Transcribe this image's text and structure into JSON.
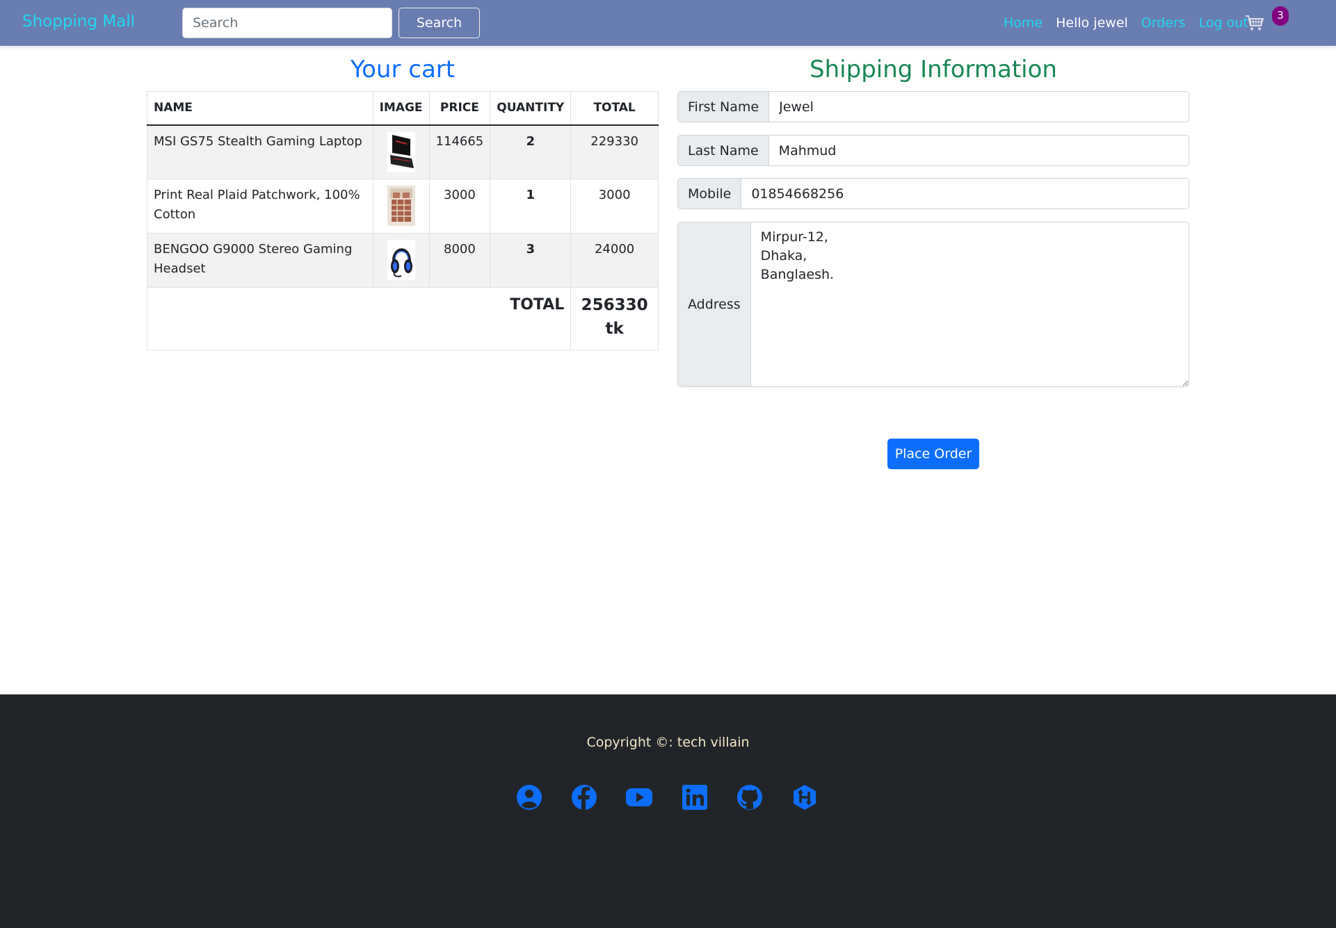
{
  "navbar": {
    "brand": "Shopping Mall",
    "search_placeholder": "Search",
    "search_button": "Search",
    "links": {
      "home": "Home",
      "greeting": "Hello jewel",
      "orders": "Orders",
      "logout": "Log out"
    },
    "cart_icon": "cart-icon",
    "cart_count": "3",
    "colors": {
      "bar": "#6a7db0",
      "link": "#20d9f2",
      "badge": "#800080"
    }
  },
  "cart": {
    "title": "Your cart",
    "columns": [
      "NAME",
      "IMAGE",
      "PRICE",
      "QUANTITY",
      "TOTAL"
    ],
    "items": [
      {
        "name": "MSI GS75 Stealth Gaming Laptop",
        "image_icon": "laptop-thumbnail",
        "price": "114665",
        "quantity": "2",
        "total": "229330"
      },
      {
        "name": "Print Real Plaid Patchwork, 100% Cotton",
        "image_icon": "bedding-thumbnail",
        "price": "3000",
        "quantity": "1",
        "total": "3000"
      },
      {
        "name": "BENGOO G9000 Stereo Gaming Headset",
        "image_icon": "headset-thumbnail",
        "price": "8000",
        "quantity": "3",
        "total": "24000"
      }
    ],
    "total_label": "TOTAL",
    "total_value": "256330",
    "total_unit": "tk"
  },
  "shipping": {
    "title": "Shipping Information",
    "first_name": {
      "label": "First Name",
      "value": "Jewel"
    },
    "last_name": {
      "label": "Last Name",
      "value": "Mahmud"
    },
    "mobile": {
      "label": "Mobile",
      "value": "01854668256"
    },
    "address": {
      "label": "Address",
      "value": "Mirpur-12,\nDhaka,\nBanglaesh."
    },
    "place_order": "Place Order"
  },
  "footer": {
    "copyright": "Copyright ©: tech villain",
    "social_icons": [
      "user-circle-icon",
      "facebook-icon",
      "youtube-icon",
      "linkedin-icon",
      "github-icon",
      "hackerrank-icon"
    ],
    "icon_color": "#0d6efd"
  }
}
